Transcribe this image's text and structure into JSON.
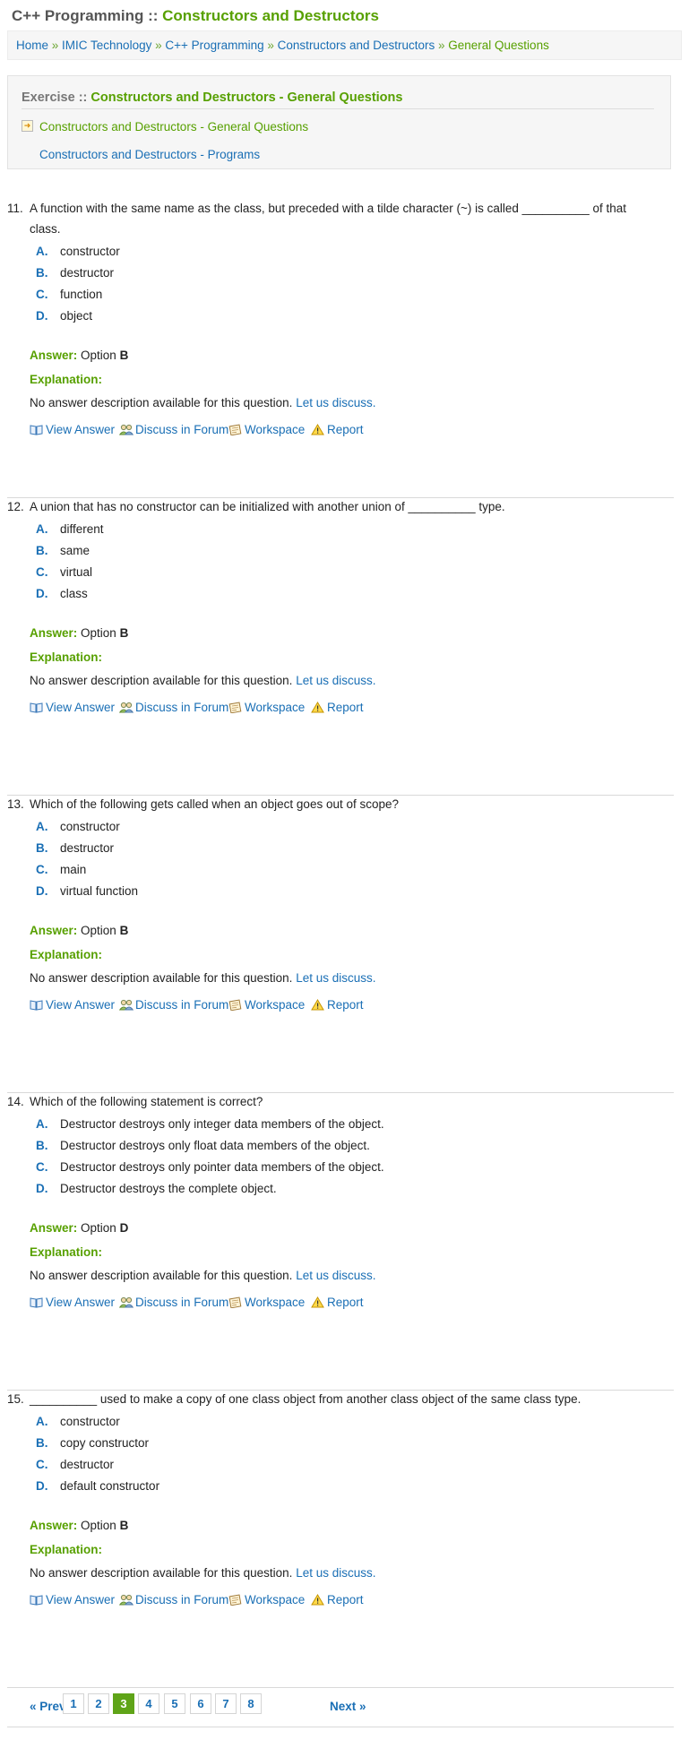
{
  "header": {
    "title_prefix": "C++ Programming :: ",
    "title_topic": "Constructors and Destructors"
  },
  "breadcrumb": {
    "items": [
      "Home",
      "IMIC Technology",
      "C++ Programming",
      "Constructors and Destructors",
      "General Questions"
    ],
    "separator": " » "
  },
  "exercise": {
    "label": "Exercise :: ",
    "title": "Constructors and Destructors - General Questions",
    "links": [
      "Constructors and Destructors - General Questions",
      "Constructors and Destructors - Programs"
    ]
  },
  "common": {
    "answer_label": "Answer:",
    "option_word": "Option",
    "explanation_label": "Explanation:",
    "explanation_text": "No answer description available for this question.",
    "discuss_link": "Let us discuss.",
    "actions": [
      "View Answer",
      "Discuss in Forum",
      "Workspace",
      "Report"
    ]
  },
  "questions": [
    {
      "number": "11.",
      "text": "A function with the same name as the class, but preceded with a tilde character (~) is called __________ of that class.",
      "options": [
        [
          "A.",
          "constructor"
        ],
        [
          "B.",
          "destructor"
        ],
        [
          "C.",
          "function"
        ],
        [
          "D.",
          "object"
        ]
      ],
      "answer": "B"
    },
    {
      "number": "12.",
      "text": "A union that has no constructor can be initialized with another union of __________ type.",
      "options": [
        [
          "A.",
          "different"
        ],
        [
          "B.",
          "same"
        ],
        [
          "C.",
          "virtual"
        ],
        [
          "D.",
          "class"
        ]
      ],
      "answer": "B"
    },
    {
      "number": "13.",
      "text": "Which of the following gets called when an object goes out of scope?",
      "options": [
        [
          "A.",
          "constructor"
        ],
        [
          "B.",
          "destructor"
        ],
        [
          "C.",
          "main"
        ],
        [
          "D.",
          "virtual function"
        ]
      ],
      "answer": "B"
    },
    {
      "number": "14.",
      "text": "Which of the following statement is correct?",
      "options": [
        [
          "A.",
          "Destructor destroys only integer data members of the object."
        ],
        [
          "B.",
          "Destructor destroys only float data members of the object."
        ],
        [
          "C.",
          "Destructor destroys only pointer data members of the object."
        ],
        [
          "D.",
          "Destructor destroys the complete object."
        ]
      ],
      "answer": "D"
    },
    {
      "number": "15.",
      "text": "__________ used to make a copy of one class object from another class object of the same class type.",
      "options": [
        [
          "A.",
          "constructor"
        ],
        [
          "B.",
          "copy constructor"
        ],
        [
          "C.",
          "destructor"
        ],
        [
          "D.",
          "default constructor"
        ]
      ],
      "answer": "B"
    }
  ],
  "pagination": {
    "prev": "« Prev",
    "next": "Next »",
    "pages": [
      "1",
      "2",
      "3",
      "4",
      "5",
      "6",
      "7",
      "8"
    ],
    "current": "3"
  },
  "colors": {
    "accent_green": "#57a000",
    "link_blue": "#1a6fb5",
    "active_page": "#5fa418"
  },
  "icons": [
    "arrow-right-icon",
    "book-icon",
    "people-icon",
    "notepad-icon",
    "warning-icon"
  ]
}
